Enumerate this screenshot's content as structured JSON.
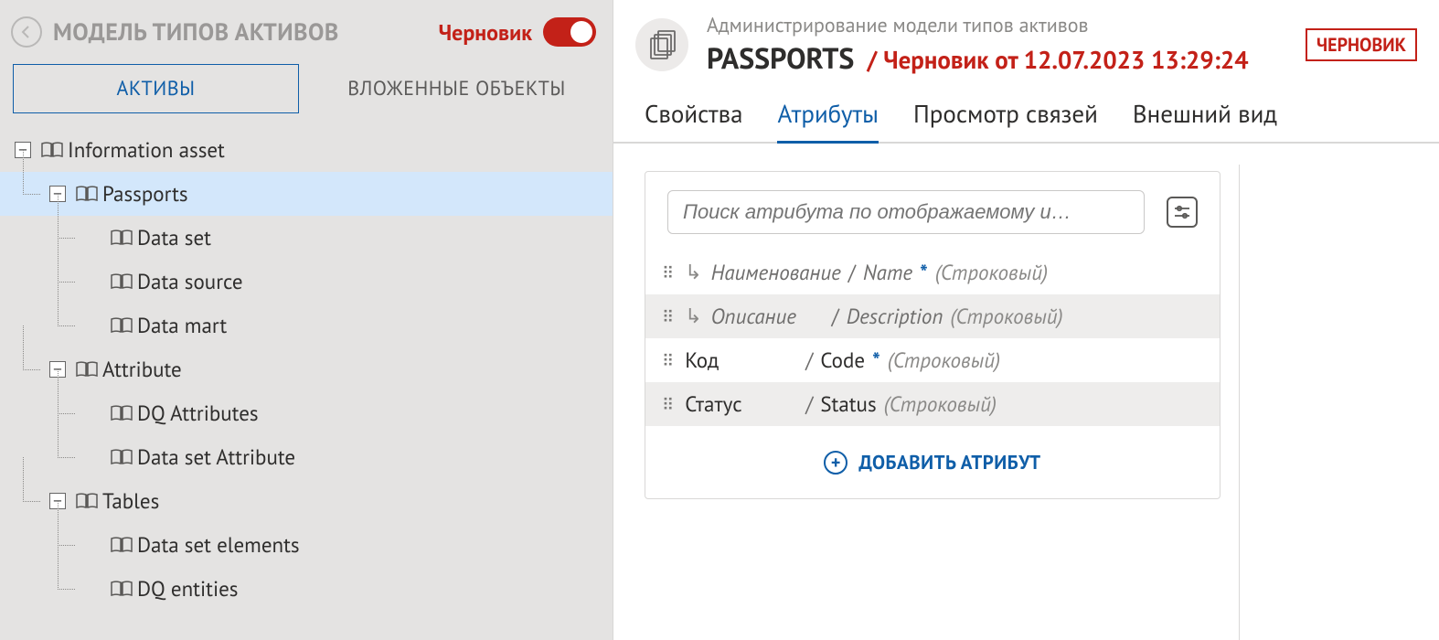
{
  "left": {
    "title": "МОДЕЛЬ ТИПОВ АКТИВОВ",
    "draft_label": "Черновик",
    "tabs": {
      "assets": "АКТИВЫ",
      "nested": "ВЛОЖЕННЫЕ ОБЪЕКТЫ"
    }
  },
  "tree": {
    "root": "Information asset",
    "n1": "Passports",
    "n1a": "Data set",
    "n1b": "Data source",
    "n1c": "Data mart",
    "n2": "Attribute",
    "n2a": "DQ Attributes",
    "n2b": "Data set Attribute",
    "n3": "Tables",
    "n3a": "Data set elements",
    "n3b": "DQ entities"
  },
  "header": {
    "subtitle": "Администрирование модели типов активов",
    "name": "PASSPORTS",
    "draft_ts": "/ Черновик от 12.07.2023 13:29:24",
    "badge": "ЧЕРНОВИК"
  },
  "tabs_right": {
    "props": "Свойства",
    "attrs": "Атрибуты",
    "links": "Просмотр связей",
    "look": "Внешний вид"
  },
  "search": {
    "placeholder": "Поиск атрибута по отображаемому и…"
  },
  "attrs": [
    {
      "ru": "Наименование",
      "en": "Name",
      "type": "(Строковый)",
      "inherited": true,
      "required": true,
      "styled": true
    },
    {
      "ru": "Описание",
      "en": "Description",
      "type": "(Строковый)",
      "inherited": true,
      "required": false,
      "styled": true
    },
    {
      "ru": "Код",
      "en": "Code",
      "type": "(Строковый)",
      "inherited": false,
      "required": true,
      "styled": false
    },
    {
      "ru": "Статус",
      "en": "Status",
      "type": "(Строковый)",
      "inherited": false,
      "required": false,
      "styled": false
    }
  ],
  "add_attr": "ДОБАВИТЬ АТРИБУТ"
}
